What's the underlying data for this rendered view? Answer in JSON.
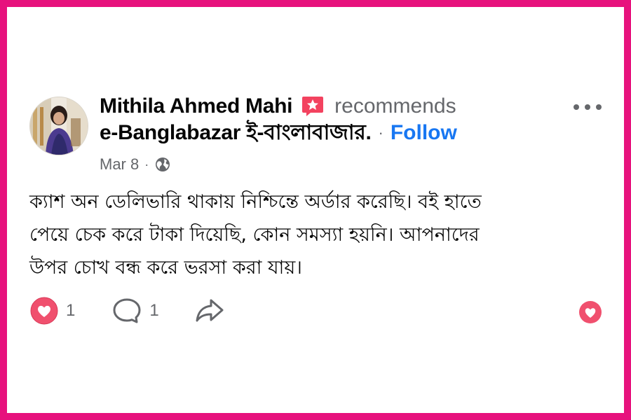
{
  "post": {
    "author": "Mithila Ahmed Mahi",
    "action_text": "recommends",
    "page_name": "e-Banglabazar ই-বাংলাবাজার.",
    "separator": "·",
    "follow_label": "Follow",
    "date": "Mar 8",
    "meta_separator": "·",
    "body_lines": [
      "ক্যাশ অন ডেলিভারি থাকায় নিশ্চিন্তে অর্ডার করেছি। বই হাতে",
      "পেয়ে চেক করে টাকা দিয়েছি, কোন সমস্যা হয়নি। আপনাদের",
      "উপর চোখ বন্ধ করে ভরসা করা যায়।"
    ]
  },
  "actions": {
    "like_count": "1",
    "comment_count": "1"
  },
  "colors": {
    "frame": "#e7127d",
    "link": "#1877f2",
    "secondary_text": "#65676b",
    "react_red": "#f0506e",
    "badge_red": "#f3425f"
  },
  "icons": {
    "badge": "recommend-star-icon",
    "privacy": "globe-icon",
    "more": "more-horizontal-icon",
    "like": "heart-reaction-icon",
    "comment": "comment-icon",
    "share": "share-icon",
    "react": "heart-reaction-icon"
  }
}
